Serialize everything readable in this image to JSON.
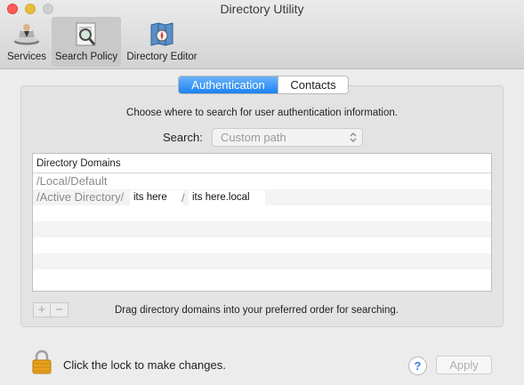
{
  "window": {
    "title": "Directory Utility"
  },
  "toolbar": {
    "items": [
      {
        "label": "Services",
        "icon": "services-icon"
      },
      {
        "label": "Search Policy",
        "icon": "search-policy-icon",
        "selected": true
      },
      {
        "label": "Directory Editor",
        "icon": "directory-editor-icon"
      }
    ]
  },
  "tabs": [
    {
      "label": "Authentication",
      "active": true
    },
    {
      "label": "Contacts",
      "active": false
    }
  ],
  "instructions": "Choose where to search for user authentication information.",
  "search": {
    "label": "Search:",
    "value": "Custom path"
  },
  "table": {
    "header": "Directory Domains",
    "rows": [
      {
        "text": "/Local/Default"
      },
      {
        "text": "/Active Directory/",
        "chips": [
          "its here",
          "/",
          "its here.local"
        ]
      }
    ]
  },
  "buttons": {
    "add": "+",
    "remove": "−",
    "apply": "Apply",
    "help": "?"
  },
  "drag_hint": "Drag directory domains into your preferred order for searching.",
  "lock_text": "Click the lock to make changes.",
  "colors": {
    "accent": "#1b82f1",
    "window_bg": "#ececec",
    "lock": "#e8a21c"
  }
}
